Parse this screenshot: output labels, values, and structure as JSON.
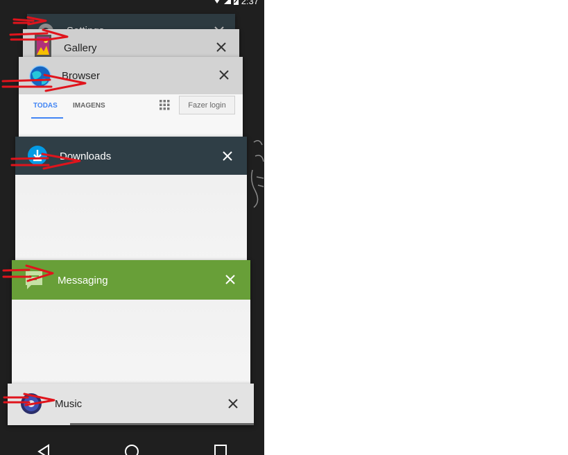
{
  "status_bar": {
    "time": "2:37"
  },
  "cards": {
    "settings": {
      "title": "Settings"
    },
    "gallery": {
      "title": "Gallery"
    },
    "browser": {
      "title": "Browser",
      "tabs": [
        "TODAS",
        "IMAGENS"
      ],
      "login_label": "Fazer login"
    },
    "downloads": {
      "title": "Downloads"
    },
    "messaging": {
      "title": "Messaging"
    },
    "music": {
      "title": "Music"
    }
  },
  "colors": {
    "settings_header": "#2d3a40",
    "gallery_header": "#cfcfcf",
    "browser_header": "#d3d3d3",
    "downloads_header": "#2f3e46",
    "messaging_header": "#689f38",
    "music_header": "#e3e3e3",
    "annotation_red": "#e0141c"
  },
  "nav": {
    "icons": [
      "back-icon",
      "home-icon",
      "recents-icon"
    ]
  }
}
